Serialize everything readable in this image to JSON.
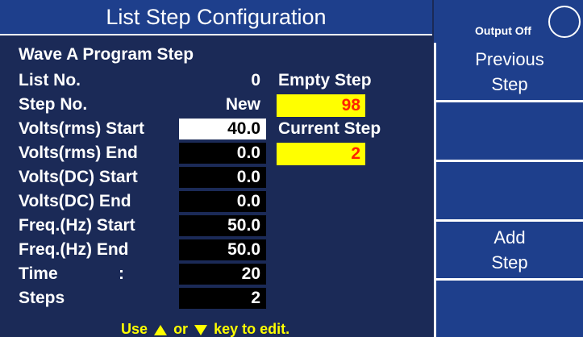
{
  "title": "List Step Configuration",
  "status": {
    "output_label": "Output Off"
  },
  "header": "Wave  A  Program Step",
  "fields": {
    "list_no": {
      "label": "List No.",
      "value": "0"
    },
    "step_no": {
      "label": "Step No.",
      "value": "New"
    },
    "volts_rms_start": {
      "label": "Volts(rms) Start",
      "value": "40.0"
    },
    "volts_rms_end": {
      "label": "Volts(rms) End",
      "value": "0.0"
    },
    "volts_dc_start": {
      "label": "Volts(DC) Start",
      "value": "0.0"
    },
    "volts_dc_end": {
      "label": "Volts(DC) End",
      "value": "0.0"
    },
    "freq_start": {
      "label": "Freq.(Hz) Start",
      "value": "50.0"
    },
    "freq_end": {
      "label": "Freq.(Hz) End",
      "value": "50.0"
    },
    "time": {
      "label": "Time",
      "colon": ":",
      "value": "20"
    },
    "steps": {
      "label": "Steps",
      "value": "2"
    }
  },
  "side": {
    "empty_step_label": "Empty Step",
    "empty_step_value": "98",
    "current_step_label": "Current Step",
    "current_step_value": "2"
  },
  "hint": {
    "part1": "Use",
    "part2": "or",
    "part3": "key to edit.",
    "up_icon": "up-triangle",
    "down_icon": "down-triangle"
  },
  "softkeys": {
    "key1_line1": "Previous",
    "key1_line2": "Step",
    "key2": "",
    "key3": "",
    "key4_line1": "Add",
    "key4_line2": "Step",
    "key5": ""
  },
  "colors": {
    "background": "#1b2a57",
    "title_bar": "#1e3f8c",
    "highlight_yellow": "#ffff00",
    "highlight_red_text": "#ff2200"
  }
}
